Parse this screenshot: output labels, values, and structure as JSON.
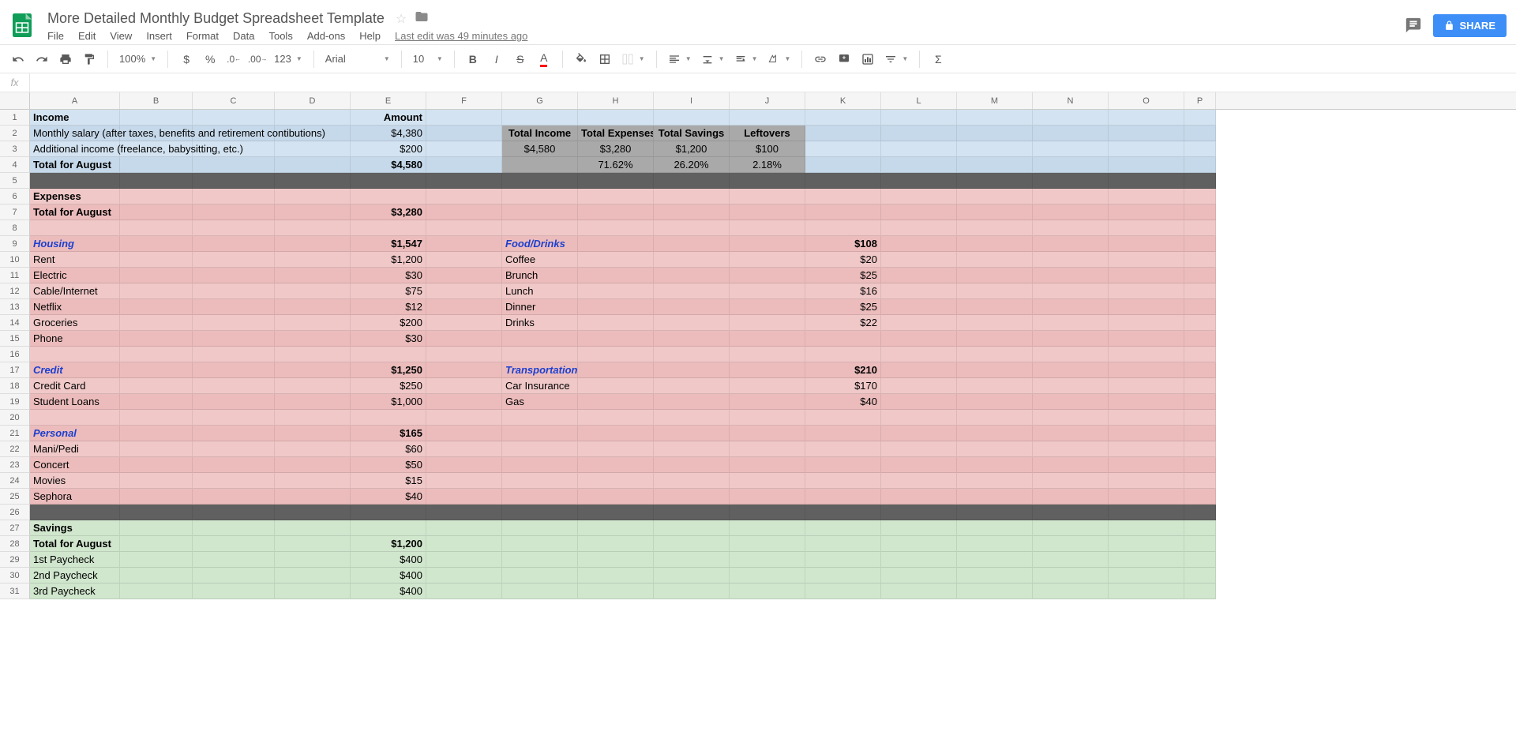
{
  "header": {
    "title": "More Detailed Monthly Budget Spreadsheet Template",
    "share": "SHARE",
    "last_edit": "Last edit was 49 minutes ago"
  },
  "menu": [
    "File",
    "Edit",
    "View",
    "Insert",
    "Format",
    "Data",
    "Tools",
    "Add-ons",
    "Help"
  ],
  "toolbar": {
    "zoom": "100%",
    "num123": "123",
    "font": "Arial",
    "size": "10"
  },
  "fx": "fx",
  "columns": [
    "A",
    "B",
    "C",
    "D",
    "E",
    "F",
    "G",
    "H",
    "I",
    "J",
    "K",
    "L",
    "M",
    "N",
    "O",
    "P"
  ],
  "cells": {
    "A1": "Income",
    "E1": "Amount",
    "A2": "Monthly salary (after taxes, benefits and retirement contibutions)",
    "E2": "$4,380",
    "G2": "Total Income",
    "H2": "Total Expenses",
    "I2": "Total Savings",
    "J2": "Leftovers",
    "A3": "Additional income (freelance, babysitting, etc.)",
    "E3": "$200",
    "G3": "$4,580",
    "H3": "$3,280",
    "I3": "$1,200",
    "J3": "$100",
    "A4": "Total for August",
    "E4": "$4,580",
    "H4": "71.62%",
    "I4": "26.20%",
    "J4": "2.18%",
    "A6": "Expenses",
    "A7": "Total for August",
    "E7": "$3,280",
    "A9": "Housing",
    "E9": "$1,547",
    "G9": "Food/Drinks",
    "K9": "$108",
    "A10": "Rent",
    "E10": "$1,200",
    "G10": "Coffee",
    "K10": "$20",
    "A11": "Electric",
    "E11": "$30",
    "G11": "Brunch",
    "K11": "$25",
    "A12": "Cable/Internet",
    "E12": "$75",
    "G12": "Lunch",
    "K12": "$16",
    "A13": "Netflix",
    "E13": "$12",
    "G13": "Dinner",
    "K13": "$25",
    "A14": "Groceries",
    "E14": "$200",
    "G14": "Drinks",
    "K14": "$22",
    "A15": "Phone",
    "E15": "$30",
    "A17": "Credit",
    "E17": "$1,250",
    "G17": "Transportation",
    "K17": "$210",
    "A18": "Credit Card",
    "E18": "$250",
    "G18": "Car Insurance",
    "K18": "$170",
    "A19": "Student Loans",
    "E19": "$1,000",
    "G19": "Gas",
    "K19": "$40",
    "A21": "Personal",
    "E21": "$165",
    "A22": "Mani/Pedi",
    "E22": "$60",
    "A23": "Concert",
    "E23": "$50",
    "A24": "Movies",
    "E24": "$15",
    "A25": "Sephora",
    "E25": "$40",
    "A27": "Savings",
    "A28": "Total for August",
    "E28": "$1,200",
    "A29": "1st Paycheck",
    "E29": "$400",
    "A30": "2nd Paycheck",
    "E30": "$400",
    "A31": "3rd Paycheck",
    "E31": "$400"
  }
}
